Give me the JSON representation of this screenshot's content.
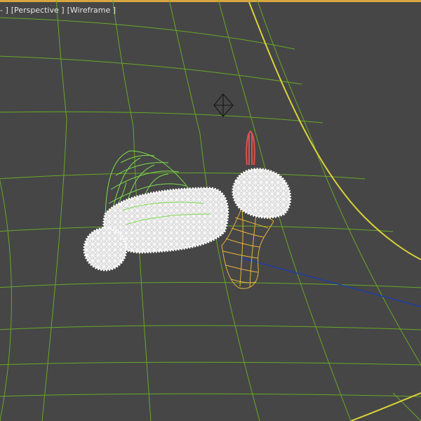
{
  "viewport": {
    "labels": {
      "menu": "- ]",
      "view": "[Perspective ]",
      "shading": "[Wireframe ]"
    },
    "colors": {
      "background": "#464646",
      "grid": "#6bb323",
      "selection": "#d8d23a",
      "hat_wire": "#7ddc4e",
      "stocking_wire": "#e7b33a",
      "hanger": "#e0514f",
      "axis": "#1f3ea8",
      "fur": "#f2f2f2",
      "top_border": "#d8a640"
    },
    "icons": [
      "light-gizmo-icon"
    ]
  }
}
